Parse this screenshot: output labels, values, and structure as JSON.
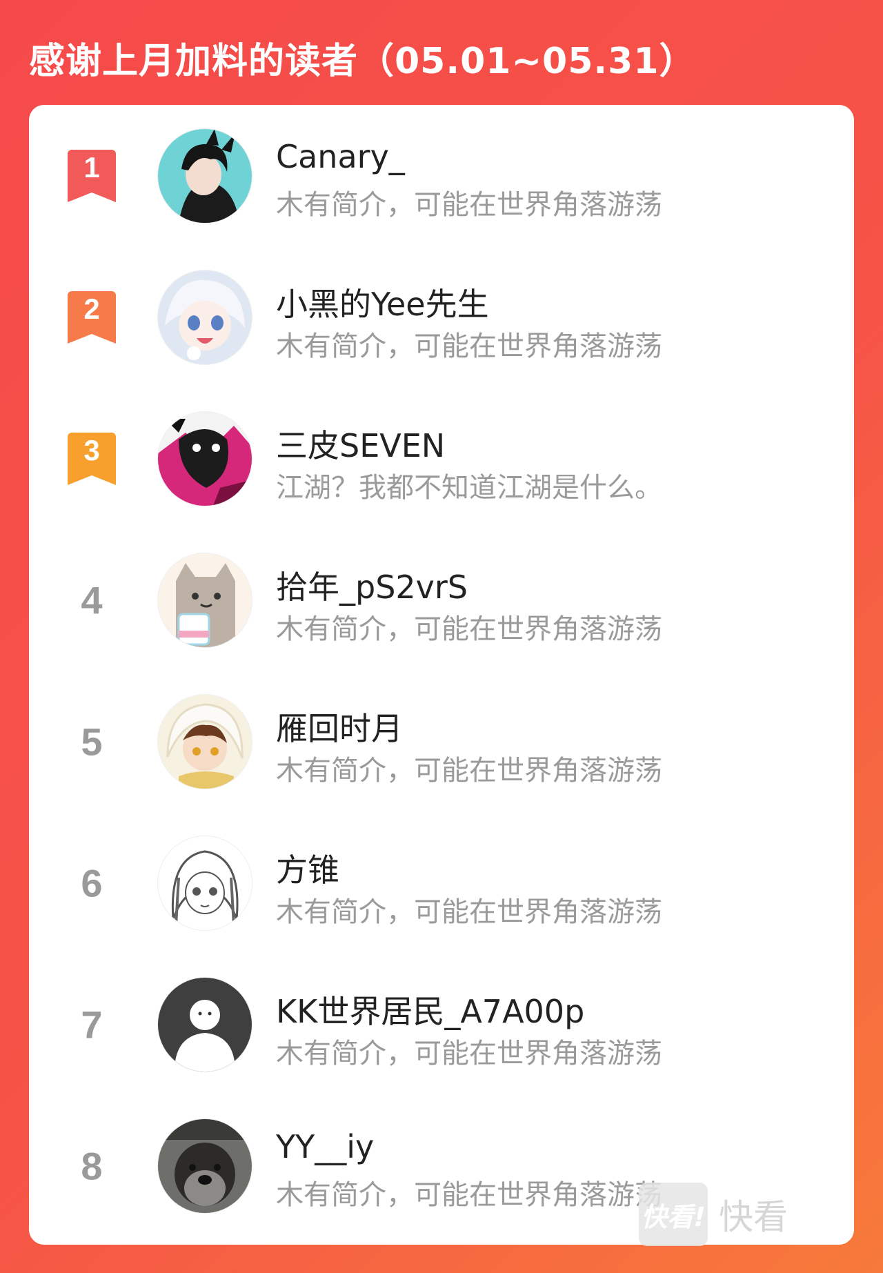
{
  "header": {
    "title": "感谢上月加料的读者（05.01~05.31）"
  },
  "colors": {
    "background": "#f54a4a",
    "rank1": "#f25a5a",
    "rank2": "#f77b4a",
    "rank3": "#f7a02e",
    "rank_plain": "#9a9a9a"
  },
  "readers": [
    {
      "rank": "1",
      "name": "Canary_",
      "bio": "木有简介，可能在世界角落游荡",
      "avatar": "avatar-anime-black-hair"
    },
    {
      "rank": "2",
      "name": "小黑的Yee先生",
      "bio": "木有简介，可能在世界角落游荡",
      "avatar": "avatar-anime-white-hair"
    },
    {
      "rank": "3",
      "name": "三皮SEVEN",
      "bio": "江湖？我都不知道江湖是什么。",
      "avatar": "avatar-pink-illustration"
    },
    {
      "rank": "4",
      "name": "拾年_pS2vrS",
      "bio": "木有简介，可能在世界角落游荡",
      "avatar": "avatar-cat-ice-cream"
    },
    {
      "rank": "5",
      "name": "雁回时月",
      "bio": "木有简介，可能在世界角落游荡",
      "avatar": "avatar-anime-hood"
    },
    {
      "rank": "6",
      "name": "方锥",
      "bio": "木有简介，可能在世界角落游荡",
      "avatar": "avatar-manga-girl"
    },
    {
      "rank": "7",
      "name": "KK世界居民_A7A00p",
      "bio": "木有简介，可能在世界角落游荡",
      "avatar": "avatar-default-person"
    },
    {
      "rank": "8",
      "name": "YY__iy",
      "bio": "木有简介，可能在世界角落游荡",
      "avatar": "avatar-dog-photo"
    }
  ],
  "watermark": {
    "logo": "快看!",
    "text": "快看"
  }
}
